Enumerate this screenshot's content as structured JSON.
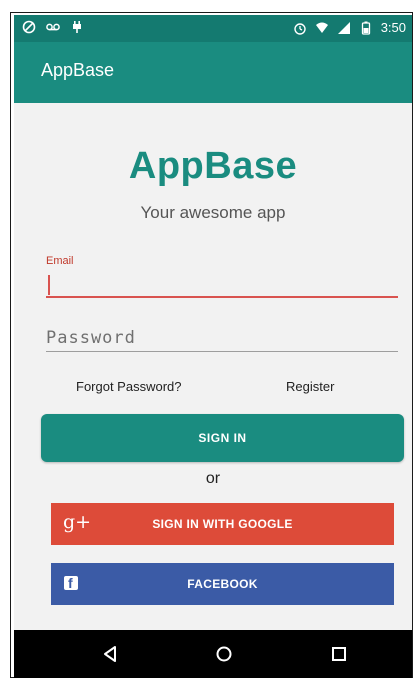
{
  "status_bar": {
    "time": "3:50",
    "left_icons": [
      "circle-slash-icon",
      "voicemail-icon",
      "plug-icon"
    ],
    "right_icons": [
      "alarm-icon",
      "wifi-icon",
      "signal-icon",
      "battery-icon"
    ]
  },
  "app_bar": {
    "title": "AppBase"
  },
  "brand": {
    "logo_text": "AppBase",
    "tagline": "Your awesome app"
  },
  "form": {
    "email_label": "Email",
    "email_value": "",
    "password_placeholder": "Password",
    "forgot_label": "Forgot Password?",
    "register_label": "Register",
    "signin_label": "SIGN IN",
    "or_label": "or",
    "google_label": "SIGN IN WITH GOOGLE",
    "google_icon_text": "g+",
    "facebook_label": "FACEBOOK",
    "facebook_icon_text": "f"
  },
  "nav_bar": {
    "icons": [
      "back-icon",
      "home-icon",
      "recents-icon"
    ]
  },
  "colors": {
    "primary": "#1a8c80",
    "primary_dark": "#147a70",
    "error": "#d9534f",
    "google": "#dd4b39",
    "facebook": "#3b5ba6"
  }
}
